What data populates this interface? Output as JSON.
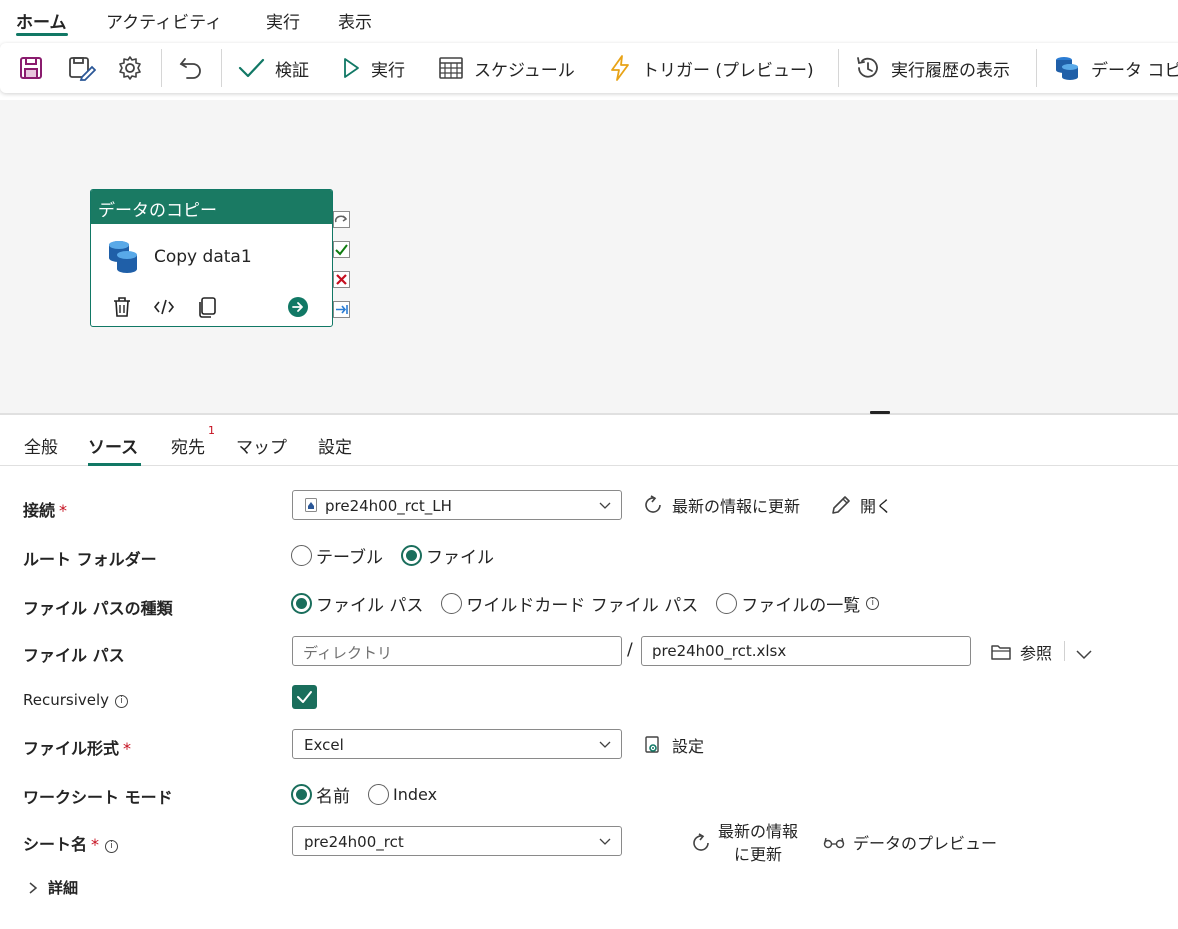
{
  "ribbon": {
    "tabs": [
      {
        "label": "ホーム",
        "active": true
      },
      {
        "label": "アクティビティ"
      },
      {
        "label": "実行"
      },
      {
        "label": "表示"
      }
    ]
  },
  "toolbar": {
    "validate": "検証",
    "run": "実行",
    "schedule": "スケジュール",
    "trigger": "トリガー (プレビュー)",
    "history": "実行履歴の表示",
    "copy_data": "データ コピ"
  },
  "activity": {
    "header": "データのコピー",
    "name": "Copy data1"
  },
  "property_tabs": {
    "general": "全般",
    "source": "ソース",
    "destination": "宛先",
    "destination_badge": "1",
    "mapping": "マップ",
    "settings": "設定"
  },
  "form": {
    "connection": {
      "label": "接続",
      "required": "*",
      "value": "pre24h00_rct_LH",
      "refresh": "最新の情報に更新",
      "open": "開く"
    },
    "root_folder": {
      "label": "ルート フォルダー",
      "options": [
        "テーブル",
        "ファイル"
      ],
      "selected": "ファイル"
    },
    "file_path_type": {
      "label": "ファイル パスの種類",
      "options": [
        "ファイル パス",
        "ワイルドカード ファイル パス",
        "ファイルの一覧"
      ],
      "selected": "ファイル パス"
    },
    "file_path": {
      "label": "ファイル パス",
      "directory_placeholder": "ディレクトリ",
      "separator": "/",
      "file_value": "pre24h00_rct.xlsx",
      "browse": "参照"
    },
    "recursively": {
      "label": "Recursively",
      "checked": true
    },
    "file_format": {
      "label": "ファイル形式",
      "required": "*",
      "value": "Excel",
      "settings": "設定"
    },
    "worksheet_mode": {
      "label": "ワークシート モード",
      "options": [
        "名前",
        "Index"
      ],
      "selected": "名前"
    },
    "sheet_name": {
      "label": "シート名",
      "required": "*",
      "value": "pre24h00_rct",
      "refresh_line1": "最新の情報",
      "refresh_line2": "に更新",
      "preview": "データのプレビュー"
    },
    "advanced": {
      "label": "詳細"
    }
  },
  "colors": {
    "accent": "#117865",
    "activity_header": "#1a7a63",
    "required": "#c50f1f"
  }
}
